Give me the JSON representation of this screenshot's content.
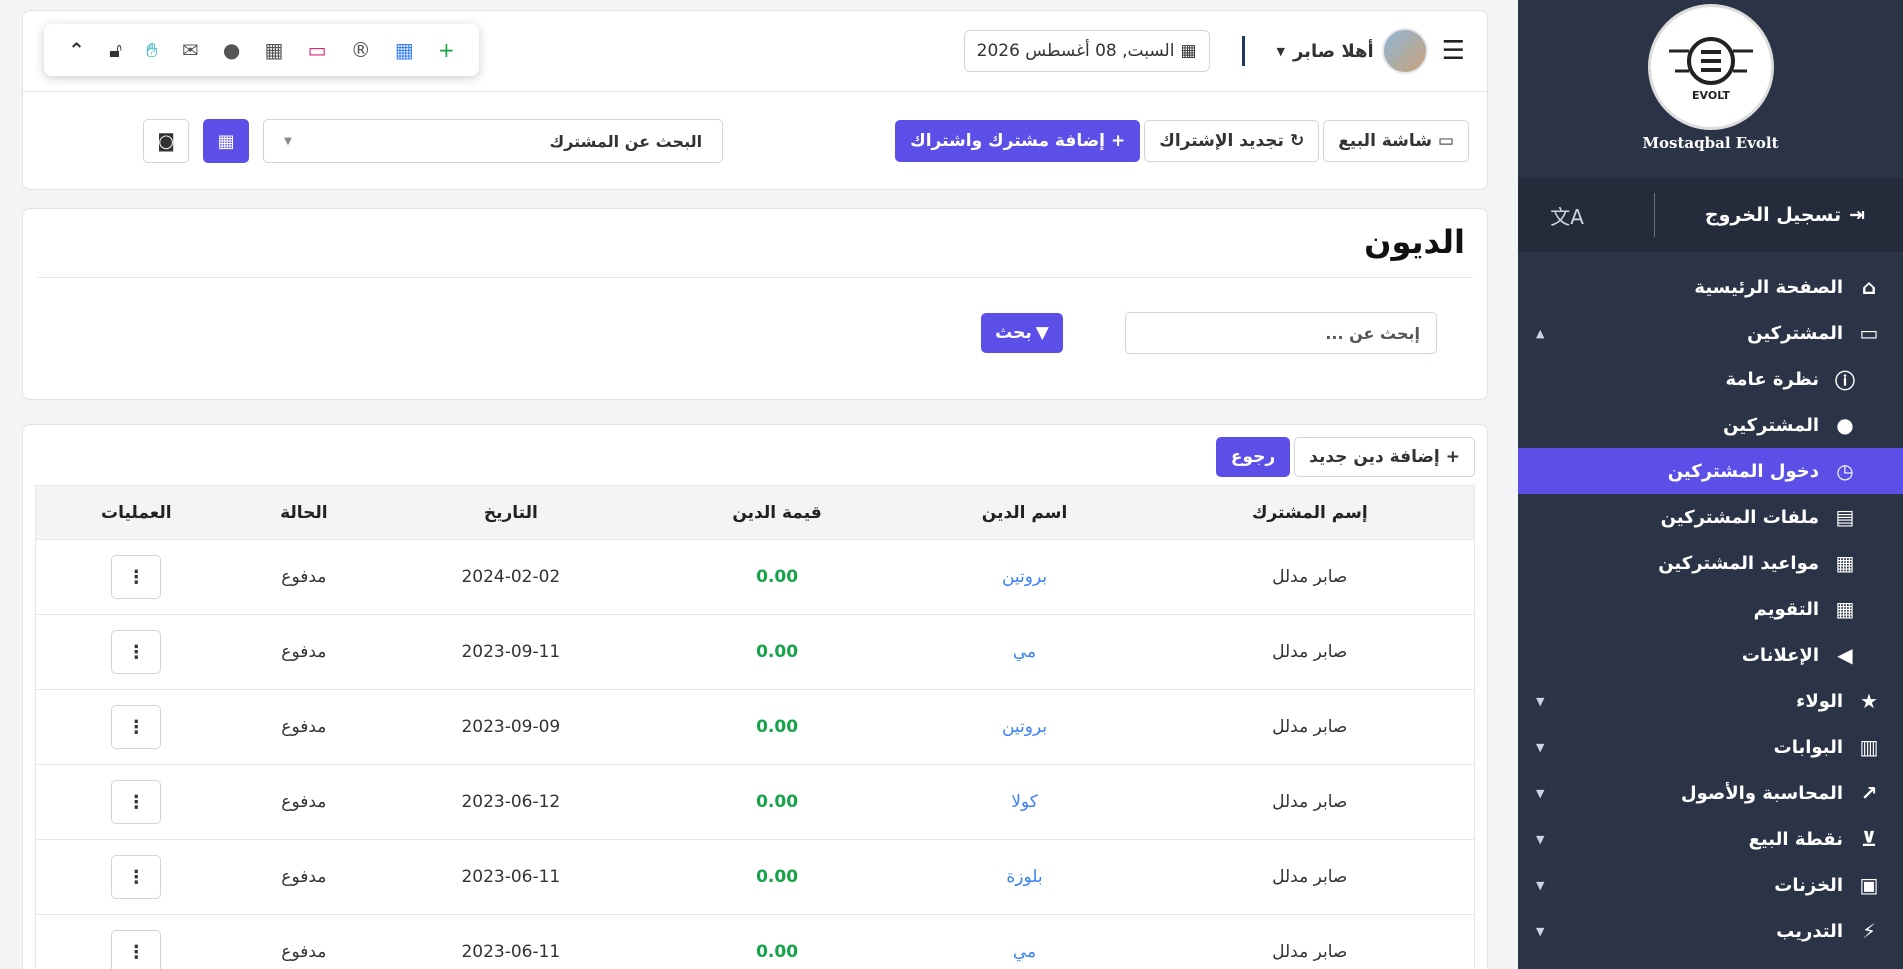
{
  "sidebar": {
    "brand": "Mostaqbal Evolt",
    "logo_text": "EVOLT",
    "logout": "تسجيل الخروج",
    "items": [
      {
        "label": "الصفحة الرئيسية",
        "icon": "home-icon",
        "glyph": "⌂"
      },
      {
        "label": "المشتركين",
        "icon": "laptop-icon",
        "glyph": "▭",
        "caret": "▲"
      },
      {
        "label": "نظرة عامة",
        "icon": "info-icon",
        "glyph": "ⓘ",
        "sub": true
      },
      {
        "label": "المشتركين",
        "icon": "user-icon",
        "glyph": "●",
        "sub": true
      },
      {
        "label": "دخول المشتركين",
        "icon": "clock-icon",
        "glyph": "◷",
        "sub": true,
        "active": true
      },
      {
        "label": "ملفات المشتركين",
        "icon": "file-icon",
        "glyph": "▤",
        "sub": true
      },
      {
        "label": "مواعيد المشتركين",
        "icon": "calendar-icon",
        "glyph": "▦",
        "sub": true
      },
      {
        "label": "التقويم",
        "icon": "calendar-grid-icon",
        "glyph": "▦",
        "sub": true
      },
      {
        "label": "الإعلانات",
        "icon": "megaphone-icon",
        "glyph": "◀",
        "sub": true
      },
      {
        "label": "الولاء",
        "icon": "star-icon",
        "glyph": "★",
        "caret": "▼"
      },
      {
        "label": "البوابات",
        "icon": "building-icon",
        "glyph": "▥",
        "caret": "▼"
      },
      {
        "label": "المحاسبة والأصول",
        "icon": "chart-line-icon",
        "glyph": "↗",
        "caret": "▼"
      },
      {
        "label": "نقطة البيع",
        "icon": "cart-icon",
        "glyph": "⊻",
        "caret": "▼"
      },
      {
        "label": "الخزنات",
        "icon": "lock-icon",
        "glyph": "▣",
        "caret": "▼"
      },
      {
        "label": "التدريب",
        "icon": "magic-wand-icon",
        "glyph": "⚡",
        "caret": "▼"
      }
    ]
  },
  "header": {
    "user_greeting": "أهلا صابر",
    "date": "السبت, 08 أغسطس 2026"
  },
  "actions": {
    "pos_screen": "شاشة البيع",
    "renew": "تجديد الإشتراك",
    "add_subscriber": "إضافة مشترك واشتراك",
    "search_subscriber": "البحث عن المشترك"
  },
  "debts": {
    "title": "الديون",
    "search_placeholder": "إبحث عن ...",
    "search_button": "بحث",
    "add_debt": "إضافة دين جديد",
    "back": "رجوع"
  },
  "table": {
    "headers": [
      "إسم المشترك",
      "اسم الدين",
      "قيمة الدين",
      "التاريخ",
      "الحالة",
      "العمليات"
    ],
    "rows": [
      {
        "subscriber": "صابر مدلل",
        "debt": "بروتين",
        "amount": "0.00",
        "date": "2024-02-02",
        "status": "مدفوع"
      },
      {
        "subscriber": "صابر مدلل",
        "debt": "مي",
        "amount": "0.00",
        "date": "2023-09-11",
        "status": "مدفوع"
      },
      {
        "subscriber": "صابر مدلل",
        "debt": "بروتين",
        "amount": "0.00",
        "date": "2023-09-09",
        "status": "مدفوع"
      },
      {
        "subscriber": "صابر مدلل",
        "debt": "كولا",
        "amount": "0.00",
        "date": "2023-06-12",
        "status": "مدفوع"
      },
      {
        "subscriber": "صابر مدلل",
        "debt": "بلوزة",
        "amount": "0.00",
        "date": "2023-06-11",
        "status": "مدفوع"
      },
      {
        "subscriber": "صابر مدلل",
        "debt": "مي",
        "amount": "0.00",
        "date": "2023-06-11",
        "status": "مدفوع"
      }
    ]
  },
  "colors": {
    "primary": "#5b4fe8",
    "sidebar": "#2b3346",
    "amount": "#16a34a",
    "link": "#3b82f6"
  }
}
